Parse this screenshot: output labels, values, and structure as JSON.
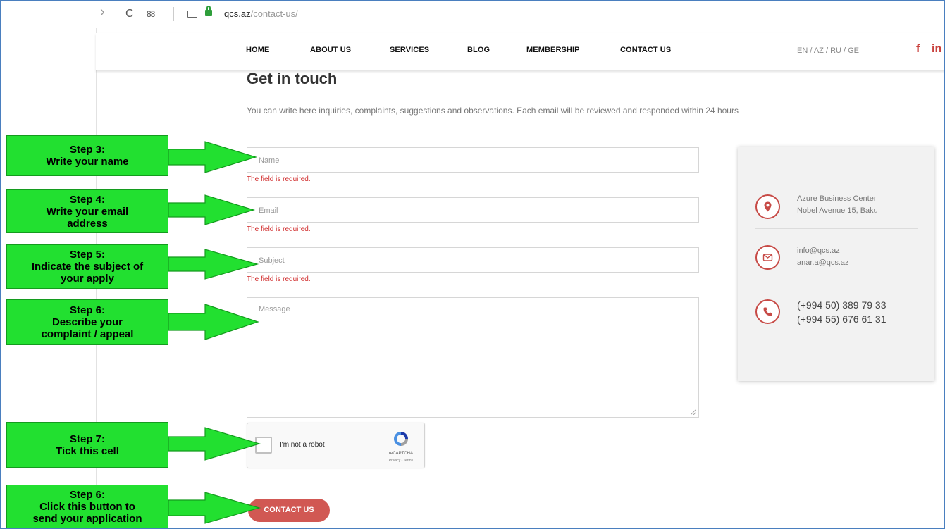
{
  "browser": {
    "back_glyph": "›",
    "reload_glyph": "C",
    "apps_glyph": "88",
    "url_host": "qcs.az",
    "url_path": "/contact-us/"
  },
  "nav": {
    "items": [
      "HOME",
      "ABOUT US",
      "SERVICES",
      "BLOG",
      "MEMBERSHIP",
      "CONTACT US"
    ],
    "languages": "EN / AZ / RU / GE",
    "social": [
      "f",
      "in"
    ]
  },
  "page": {
    "title": "Get in touch",
    "intro": "You can write here inquiries, complaints, suggestions and observations. Each email will be reviewed and responded within 24 hours"
  },
  "form": {
    "name_placeholder": "Name",
    "email_placeholder": "Email",
    "subject_placeholder": "Subject",
    "message_placeholder": "Message",
    "error_text": "The field is required.",
    "captcha_label": "I'm not a robot",
    "captcha_brand": "reCAPTCHA",
    "captcha_links": "Privacy - Terms",
    "submit_label": "CONTACT US"
  },
  "contact": {
    "address_line1": "Azure Business Center",
    "address_line2": "Nobel Avenue 15, Baku",
    "email_line1": "info@qcs.az",
    "email_line2": "anar.a@qcs.az",
    "phone_line1": "(+994 50) 389 79 33",
    "phone_line2": "(+994 55) 676 61 31"
  },
  "annotations": [
    {
      "lines": [
        "Step 3:",
        "Write your name"
      ]
    },
    {
      "lines": [
        "Step 4:",
        "Write your email",
        "address"
      ]
    },
    {
      "lines": [
        "Step 5:",
        "Indicate the subject of",
        "your apply"
      ]
    },
    {
      "lines": [
        "Step 6:",
        "Describe your",
        "complaint / appeal"
      ]
    },
    {
      "lines": [
        "Step 7:",
        "Tick this cell"
      ]
    },
    {
      "lines": [
        "Step 6:",
        "Click this button to",
        "send your application"
      ]
    }
  ],
  "colors": {
    "accent": "#d15853",
    "callout_green": "#22e030",
    "error_red": "#d02a2a"
  }
}
